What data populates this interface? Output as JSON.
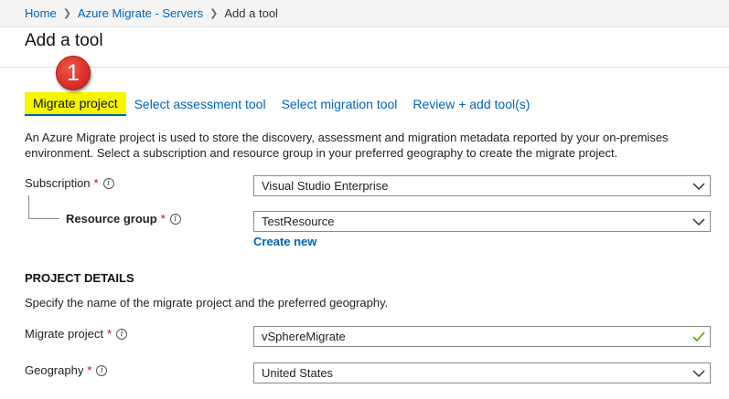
{
  "breadcrumb": {
    "items": [
      "Home",
      "Azure Migrate - Servers"
    ],
    "current": "Add a tool"
  },
  "page": {
    "title": "Add a tool"
  },
  "callout": {
    "number": "1"
  },
  "tabs": [
    {
      "label": "Migrate project",
      "active": true
    },
    {
      "label": "Select assessment tool",
      "active": false
    },
    {
      "label": "Select migration tool",
      "active": false
    },
    {
      "label": "Review + add tool(s)",
      "active": false
    }
  ],
  "description": "An Azure Migrate project is used to store the discovery, assessment and migration metadata reported by your on-premises environment. Select a subscription and resource group in your preferred geography to create the migrate project.",
  "form": {
    "subscription": {
      "label": "Subscription",
      "required": "*",
      "value": "Visual Studio Enterprise"
    },
    "resource_group": {
      "label": "Resource group",
      "required": "*",
      "value": "TestResource",
      "create_new": "Create new"
    },
    "project_details": {
      "heading": "PROJECT DETAILS",
      "description": "Specify the name of the migrate project and the preferred geography."
    },
    "migrate_project": {
      "label": "Migrate project",
      "required": "*",
      "value": "vSphereMigrate"
    },
    "geography": {
      "label": "Geography",
      "required": "*",
      "value": "United States"
    }
  },
  "icons": {
    "info": "info-icon",
    "chevron": "chevron-down-icon",
    "valid": "checkmark-icon"
  },
  "colors": {
    "link": "#0063b1",
    "highlight": "#f5f500",
    "required": "#d40000",
    "callout": "#d9302a",
    "valid_check": "#57a300"
  }
}
